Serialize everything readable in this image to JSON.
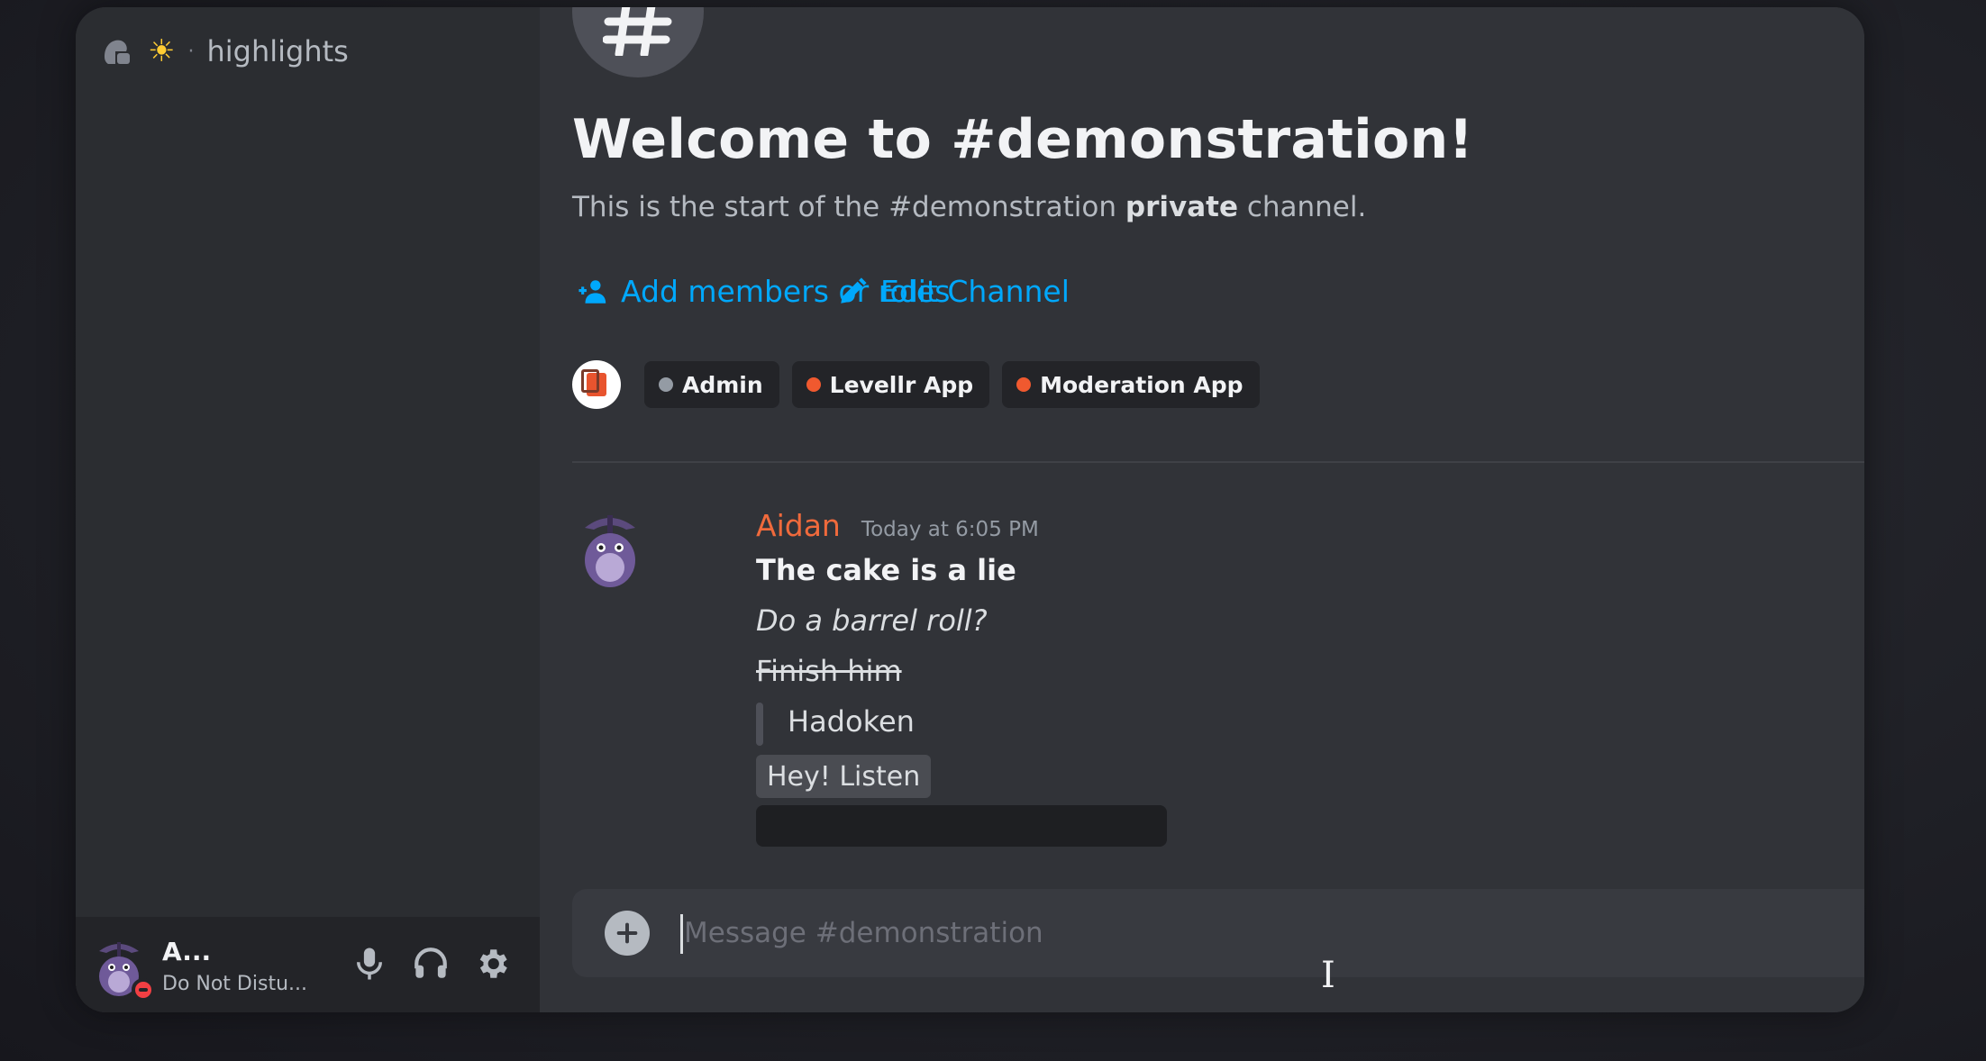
{
  "sidebar": {
    "channel": {
      "icon": "thread-icon",
      "emoji_icon": "sun-icon",
      "separator": "·",
      "name": "highlights"
    }
  },
  "user_panel": {
    "name": "A...",
    "status": "Do Not Distu...",
    "status_color": "#f23f43",
    "buttons": [
      "microphone-icon",
      "headphones-icon",
      "gear-icon"
    ]
  },
  "channel_intro": {
    "title": "Welcome to #demonstration!",
    "subtitle_prefix": "This is the start of the #demonstration ",
    "subtitle_bold": "private",
    "subtitle_suffix": " channel.",
    "actions": [
      {
        "label": "Add members or roles",
        "icon": "add-members-icon"
      },
      {
        "label": "Edit Channel",
        "icon": "pencil-icon"
      }
    ],
    "roles": [
      {
        "label": "Admin",
        "color": "#949ba4"
      },
      {
        "label": "Levellr App",
        "color": "#f0592f"
      },
      {
        "label": "Moderation App",
        "color": "#f0592f"
      }
    ]
  },
  "message": {
    "author": "Aidan",
    "author_color": "#f06a3c",
    "timestamp": "Today at 6:05 PM",
    "lines": {
      "bold": "The cake is a lie",
      "italic": "Do a barrel roll?",
      "strike": "Finish him",
      "quote": "Hadoken",
      "code": "Hey! Listen"
    }
  },
  "composer": {
    "placeholder": "Message #demonstration"
  },
  "colors": {
    "link": "#00a8fc",
    "background": "#313338",
    "sidebar": "#2b2d31"
  }
}
